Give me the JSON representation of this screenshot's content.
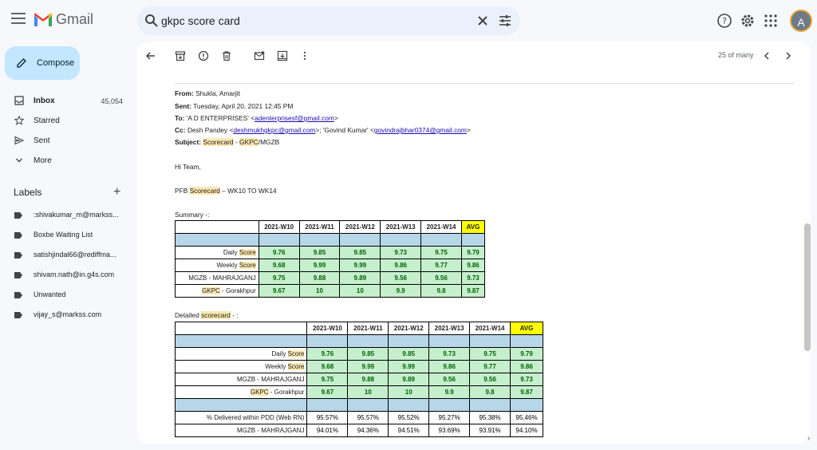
{
  "app": {
    "logo_text": "Gmail",
    "brand_colors": {
      "red": "#ea4335",
      "blue": "#4285f4",
      "green": "#34a853",
      "yellow": "#fbbc04"
    }
  },
  "search": {
    "value": "gkpc score card"
  },
  "account": {
    "avatar_letter": "A"
  },
  "sidebar": {
    "compose_label": "Compose",
    "nav": [
      {
        "label": "Inbox",
        "count": "45,054",
        "icon": "inbox-icon"
      },
      {
        "label": "Starred",
        "count": "",
        "icon": "star-icon"
      },
      {
        "label": "Sent",
        "count": "",
        "icon": "send-icon"
      },
      {
        "label": "More",
        "count": "",
        "icon": "chevron-down-icon"
      }
    ],
    "labels_heading": "Labels",
    "labels": [
      ":shivakumar_m@markss...",
      "Boxbe Waiting List",
      "satishjindal66@rediffma...",
      "shivam.nath@in.g4s.com",
      "Unwanted",
      "vijay_s@markss.com"
    ]
  },
  "toolbar": {
    "pager": "25 of many"
  },
  "email": {
    "from_label": "From:",
    "from": "Shukla, Amarjit",
    "sent_label": "Sent:",
    "sent": "Tuesday, April 20, 2021 12:45 PM",
    "to_label": "To:",
    "to_name": "'A D ENTERPRISES' <",
    "to_email": "adenterprisesf@gmail.com",
    "to_end": ">",
    "cc_label": "Cc:",
    "cc_name1": "Desh Pandey <",
    "cc_email1": "deshmukhgkpc@gmail.com",
    "cc_mid": ">; 'Govind Kumar' <",
    "cc_email2": "govindrajbhar0374@gmail.com",
    "cc_end": ">",
    "subject_label": "Subject:",
    "subject_part1": "Scorecard",
    "subject_sep1": " - ",
    "subject_part2": "GKPC",
    "subject_part3": "/MGZB",
    "greeting": "Hi Team,",
    "pfb_prefix": "PFB ",
    "pfb_hl": "Scorecard",
    "pfb_suffix": " – WK10 TO WK14",
    "summary_label": "Summary -:",
    "detailed_prefix": "Detailed ",
    "detailed_hl": "scorecard",
    "detailed_suffix": " - :"
  },
  "summary_table": {
    "columns": [
      "2021-W10",
      "2021-W11",
      "2021-W12",
      "2021-W13",
      "2021-W14",
      "AVG"
    ],
    "rows": [
      {
        "pre": "Daily ",
        "hl": "Score",
        "post": "",
        "values": [
          "9.76",
          "9.85",
          "9.85",
          "9.73",
          "9.75",
          "9.79"
        ]
      },
      {
        "pre": "Weekly ",
        "hl": "Score",
        "post": "",
        "values": [
          "9.68",
          "9.99",
          "9.99",
          "9.86",
          "9.77",
          "9.86"
        ]
      },
      {
        "pre": "MGZB - MAHRAJGANJ",
        "hl": "",
        "post": "",
        "values": [
          "9.75",
          "9.88",
          "9.89",
          "9.56",
          "9.56",
          "9.73"
        ]
      },
      {
        "pre": "",
        "hl": "GKPC",
        "post": " - Gorakhpur",
        "values": [
          "9.67",
          "10",
          "10",
          "9.9",
          "9.8",
          "9.87"
        ]
      }
    ]
  },
  "detailed_table": {
    "columns": [
      "2021-W10",
      "2021-W11",
      "2021-W12",
      "2021-W13",
      "2021-W14",
      "AVG"
    ],
    "rows": [
      {
        "pre": "Daily ",
        "hl": "Score",
        "post": "",
        "values": [
          "9.76",
          "9.85",
          "9.85",
          "9.73",
          "9.75",
          "9.79"
        ]
      },
      {
        "pre": "Weekly ",
        "hl": "Score",
        "post": "",
        "values": [
          "9.68",
          "9.99",
          "9.99",
          "9.86",
          "9.77",
          "9.86"
        ]
      },
      {
        "pre": "MGZB - MAHRAJGANJ",
        "hl": "",
        "post": "",
        "values": [
          "9.75",
          "9.88",
          "9.89",
          "9.56",
          "9.56",
          "9.73"
        ]
      },
      {
        "pre": "",
        "hl": "GKPC",
        "post": " - Gorakhpur",
        "values": [
          "9.67",
          "10",
          "10",
          "9.9",
          "9.8",
          "9.87"
        ]
      }
    ],
    "pdd_rows": [
      {
        "label": "% Delivered within PDD (Web RN)",
        "values": [
          "95.57%",
          "95.57%",
          "95.52%",
          "95.27%",
          "95.38%",
          "95.46%"
        ]
      },
      {
        "label": "MGZB - MAHRAJGANJ",
        "values": [
          "94.01%",
          "94.36%",
          "94.51%",
          "93.69%",
          "93.91%",
          "94.10%"
        ]
      }
    ]
  }
}
